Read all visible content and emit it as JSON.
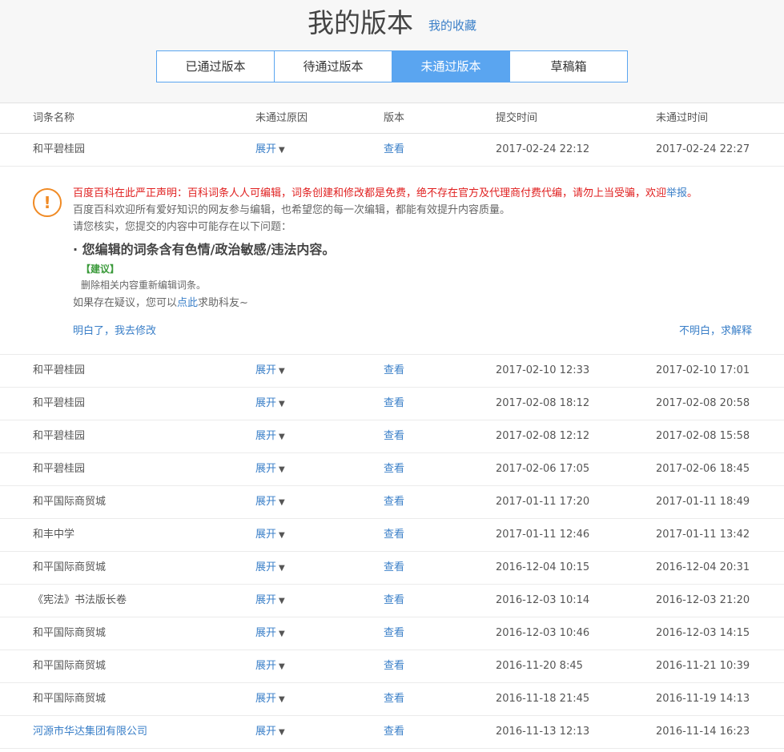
{
  "header": {
    "title": "我的版本",
    "favorites_link": "我的收藏"
  },
  "tabs": [
    {
      "label": "已通过版本",
      "active": false
    },
    {
      "label": "待通过版本",
      "active": false
    },
    {
      "label": "未通过版本",
      "active": true
    },
    {
      "label": "草稿箱",
      "active": false
    }
  ],
  "table": {
    "columns": [
      "词条名称",
      "未通过原因",
      "版本",
      "提交时间",
      "未通过时间"
    ],
    "expand_label": "展开",
    "expand_arrow": "▼",
    "view_label": "查看",
    "first_row": {
      "name": "和平碧桂园",
      "submitted": "2017-02-24 22:12",
      "rejected": "2017-02-24 22:27"
    },
    "rows": [
      {
        "name": "和平碧桂园",
        "submitted": "2017-02-10 12:33",
        "rejected": "2017-02-10 17:01"
      },
      {
        "name": "和平碧桂园",
        "submitted": "2017-02-08 18:12",
        "rejected": "2017-02-08 20:58"
      },
      {
        "name": "和平碧桂园",
        "submitted": "2017-02-08 12:12",
        "rejected": "2017-02-08 15:58"
      },
      {
        "name": "和平碧桂园",
        "submitted": "2017-02-06 17:05",
        "rejected": "2017-02-06 18:45"
      },
      {
        "name": "和平国际商贸城",
        "submitted": "2017-01-11 17:20",
        "rejected": "2017-01-11 18:49"
      },
      {
        "name": "和丰中学",
        "submitted": "2017-01-11 12:46",
        "rejected": "2017-01-11 13:42"
      },
      {
        "name": "和平国际商贸城",
        "submitted": "2016-12-04 10:15",
        "rejected": "2016-12-04 20:31"
      },
      {
        "name": "《宪法》书法版长卷",
        "submitted": "2016-12-03 10:14",
        "rejected": "2016-12-03 21:20"
      },
      {
        "name": "和平国际商贸城",
        "submitted": "2016-12-03 10:46",
        "rejected": "2016-12-03 14:15"
      },
      {
        "name": "和平国际商贸城",
        "submitted": "2016-11-20 8:45",
        "rejected": "2016-11-21 10:39"
      },
      {
        "name": "和平国际商贸城",
        "submitted": "2016-11-18 21:45",
        "rejected": "2016-11-19 14:13"
      },
      {
        "name": "河源市华达集团有限公司",
        "submitted": "2016-11-13 12:13",
        "rejected": "2016-11-14 16:23",
        "is_link": true
      }
    ]
  },
  "detail": {
    "warn_symbol": "!",
    "notice_red": "百度百科在此严正声明：百科词条人人可编辑，词条创建和修改都是免费，绝不存在官方及代理商付费代编，请勿上当受骗，欢迎",
    "notice_link": "举报",
    "notice_end": "。",
    "welcome": "百度百科欢迎所有爱好知识的网友参与编辑，也希望您的每一次编辑，都能有效提升内容质量。",
    "check": "请您核实，您提交的内容中可能存在以下问题：",
    "issue": "· 您编辑的词条含有色情/政治敏感/违法内容。",
    "suggestion_title": "【建议】",
    "suggestion": "删除相关内容重新编辑词条。",
    "doubt_prefix": "如果存在疑议，您可以",
    "doubt_link": "点此",
    "doubt_suffix": "求助科友~",
    "understood": "明白了，我去修改",
    "not_understood": "不明白，求解释"
  },
  "colors": {
    "accent": "#5aa5f0",
    "link": "#3a7fc8",
    "warning": "#f08a24",
    "alert_red": "#e02020",
    "suggestion_green": "#3a9a3a"
  }
}
